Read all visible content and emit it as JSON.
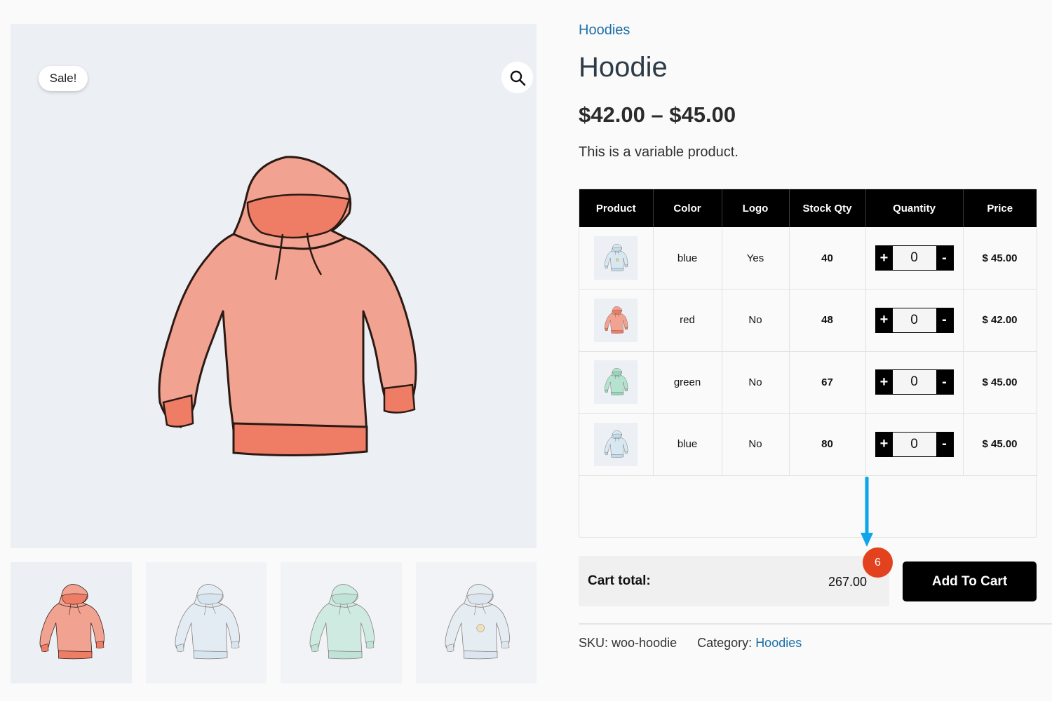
{
  "gallery": {
    "sale_badge": "Sale!",
    "thumbnails": [
      {
        "icon": "hoodie-red-icon",
        "color": "#f19a8a"
      },
      {
        "icon": "hoodie-blue-icon",
        "color": "#cfe2ee"
      },
      {
        "icon": "hoodie-green-icon",
        "color": "#a9dcc8"
      },
      {
        "icon": "hoodie-blue-logo-icon",
        "color": "#d6e3ec"
      }
    ]
  },
  "product": {
    "category": "Hoodies",
    "title": "Hoodie",
    "price_range": "$42.00 – $45.00",
    "short_description": "This is a variable product."
  },
  "table": {
    "headers": [
      "Product",
      "Color",
      "Logo",
      "Stock Qty",
      "Quantity",
      "Price"
    ],
    "rows": [
      {
        "color": "blue",
        "logo": "Yes",
        "stock": "40",
        "qty": "0",
        "price": "$ 45.00",
        "swatch": "#cfe2ee"
      },
      {
        "color": "red",
        "logo": "No",
        "stock": "48",
        "qty": "0",
        "price": "$ 42.00",
        "swatch": "#f19a8a"
      },
      {
        "color": "green",
        "logo": "No",
        "stock": "67",
        "qty": "0",
        "price": "$ 45.00",
        "swatch": "#a9dcc8"
      },
      {
        "color": "blue",
        "logo": "No",
        "stock": "80",
        "qty": "0",
        "price": "$ 45.00",
        "swatch": "#cfe2ee"
      }
    ],
    "plus_label": "+",
    "minus_label": "-"
  },
  "cart": {
    "total_label": "Cart total:",
    "total_value": "267.00",
    "count_badge": "6",
    "add_button": "Add To Cart"
  },
  "meta": {
    "sku_label": "SKU:",
    "sku_value": "woo-hoodie",
    "category_label": "Category:",
    "category_value": "Hoodies"
  },
  "colors": {
    "link": "#1c6fa8",
    "badge": "#e2431e",
    "arrow": "#0ea5ea",
    "header_bg": "#000000"
  }
}
